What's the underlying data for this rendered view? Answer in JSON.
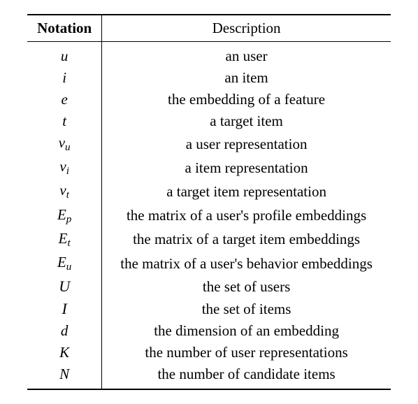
{
  "table": {
    "headers": {
      "notation": "Notation",
      "description": "Description"
    },
    "rows": [
      {
        "notation_html": "u",
        "description": "an user"
      },
      {
        "notation_html": "i",
        "description": "an item"
      },
      {
        "notation_html": "e",
        "description": "the embedding of a feature"
      },
      {
        "notation_html": "t",
        "description": "a target item"
      },
      {
        "notation_html": "v<span class=\"sub\">u</span>",
        "description": "a user representation"
      },
      {
        "notation_html": "v<span class=\"sub\">i</span>",
        "description": "a item representation"
      },
      {
        "notation_html": "v<span class=\"sub\">t</span>",
        "description": "a target item representation"
      },
      {
        "notation_html": "E<span class=\"sub\">p</span>",
        "description": "the matrix of a user's profile embeddings"
      },
      {
        "notation_html": "E<span class=\"sub\">t</span>",
        "description": "the matrix of a target item embeddings"
      },
      {
        "notation_html": "E<span class=\"sub\">u</span>",
        "description": "the matrix of a user's behavior embeddings"
      },
      {
        "notation_html": "<span class=\"cal\">U</span>",
        "description": "the set of users"
      },
      {
        "notation_html": "<span class=\"cal\">I</span>",
        "description": "the set of items"
      },
      {
        "notation_html": "d",
        "description": "the dimension of an embedding"
      },
      {
        "notation_html": "K",
        "description": "the number of user representations"
      },
      {
        "notation_html": "N",
        "description": "the number of candidate items"
      }
    ]
  }
}
